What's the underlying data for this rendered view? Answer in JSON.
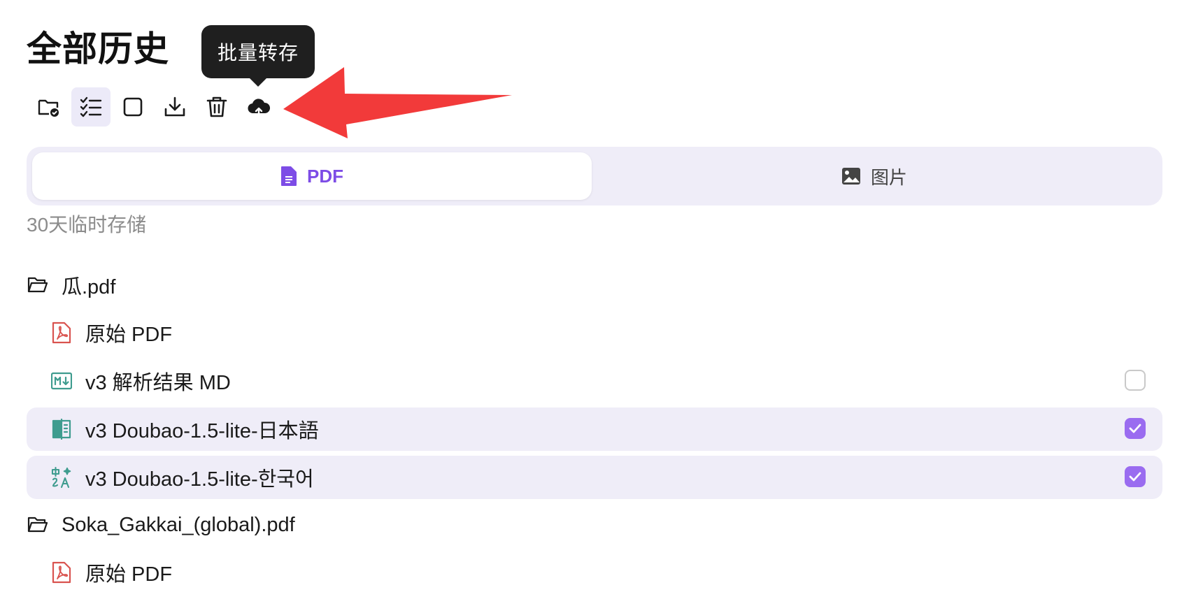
{
  "header": {
    "title": "全部历史"
  },
  "toolbar": {
    "buttons": [
      {
        "name": "folder-check-button",
        "icon": "folder-check-icon",
        "active": false
      },
      {
        "name": "multi-select-button",
        "icon": "list-check-icon",
        "active": true
      },
      {
        "name": "select-all-checkbox",
        "icon": "square-icon",
        "active": false
      },
      {
        "name": "download-button",
        "icon": "download-icon",
        "active": false
      },
      {
        "name": "delete-button",
        "icon": "trash-icon",
        "active": false
      },
      {
        "name": "batch-save-button",
        "icon": "cloud-upload-icon",
        "active": false
      }
    ],
    "tooltip": "批量转存"
  },
  "tabs": {
    "pdf_label": "PDF",
    "images_label": "图片",
    "active": "PDF"
  },
  "storage_note": "30天临时存储",
  "files": [
    {
      "name": "瓜.pdf",
      "items": [
        {
          "label": "原始 PDF",
          "icon": "pdf-file-icon",
          "checkbox": null
        },
        {
          "label": "v3 解析结果 MD",
          "icon": "markdown-icon",
          "checkbox": false
        },
        {
          "label": "v3 Doubao-1.5-lite-日本語",
          "icon": "bilingual-book-icon",
          "checkbox": true
        },
        {
          "label": "v3 Doubao-1.5-lite-한국어",
          "icon": "translate-icon",
          "checkbox": true
        }
      ]
    },
    {
      "name": "Soka_Gakkai_(global).pdf",
      "items": [
        {
          "label": "原始 PDF",
          "icon": "pdf-file-icon",
          "checkbox": null
        }
      ]
    }
  ],
  "colors": {
    "accent": "#9a6cf0",
    "accent_text": "#7d4ce6",
    "selected_row_bg": "#efedf8",
    "tooltip_bg": "#1f1f1f",
    "arrow": "#f23a3a",
    "pdf_icon": "#d9534f",
    "teal_icon": "#3f9c8f"
  }
}
